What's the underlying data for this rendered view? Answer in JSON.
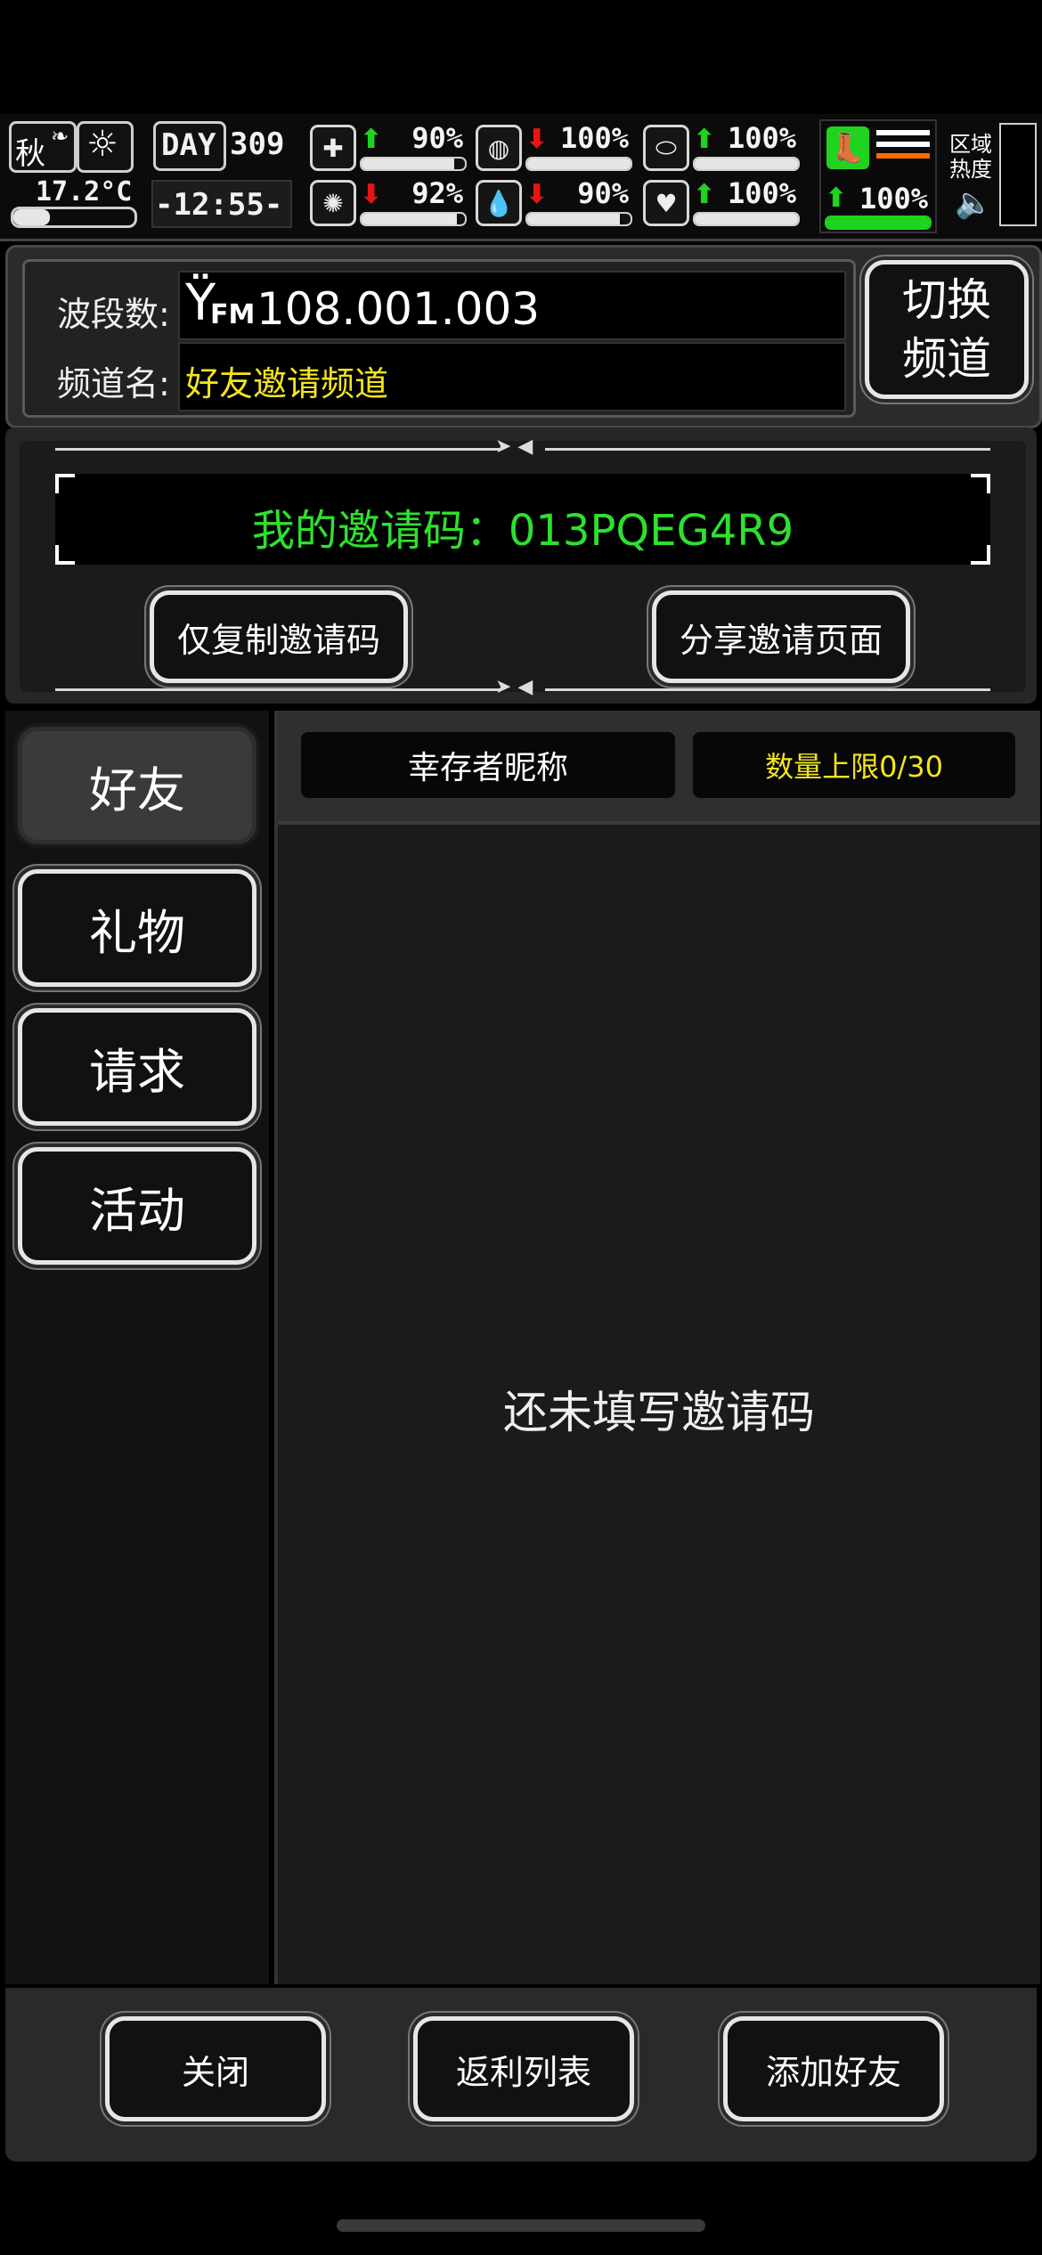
{
  "hud": {
    "season": "秋",
    "temperature": "17.2°C",
    "day_label": "DAY",
    "day_number": "309",
    "clock": "-12:55-",
    "stats": [
      {
        "name": "health",
        "icon": "medkit-icon",
        "trend": "up",
        "value": "90%",
        "level": 0.9
      },
      {
        "name": "hunger",
        "icon": "stomach-icon",
        "trend": "down",
        "value": "100%",
        "level": 1.0
      },
      {
        "name": "medicine",
        "icon": "pill-icon",
        "trend": "up",
        "value": "100%",
        "level": 1.0
      },
      {
        "name": "mood",
        "icon": "brain-icon",
        "trend": "down",
        "value": "92%",
        "level": 0.92
      },
      {
        "name": "thirst",
        "icon": "water-drop-icon",
        "trend": "down",
        "value": "90%",
        "level": 0.9
      },
      {
        "name": "heart",
        "icon": "heart-icon",
        "trend": "up",
        "value": "100%",
        "level": 1.0
      }
    ],
    "stamina": {
      "trend": "up",
      "value": "100%",
      "level": 1.0
    },
    "region_heat_label": "区域\n热度"
  },
  "channel": {
    "band_label": "波段数:",
    "band_prefix": "FM",
    "band_value": "108.001.003",
    "name_label": "频道名:",
    "name_value": "好友邀请频道",
    "switch_button": "切换\n频道"
  },
  "invite": {
    "code_text": "我的邀请码：013PQEG4R9",
    "copy_button": "仅复制邀请码",
    "share_button": "分享邀请页面"
  },
  "tabs": [
    {
      "id": "friends",
      "label": "好友",
      "active": true
    },
    {
      "id": "gifts",
      "label": "礼物",
      "active": false
    },
    {
      "id": "requests",
      "label": "请求",
      "active": false
    },
    {
      "id": "events",
      "label": "活动",
      "active": false
    }
  ],
  "list": {
    "col_nickname": "幸存者昵称",
    "col_limit": "数量上限0/30",
    "empty_message": "还未填写邀请码"
  },
  "footer": {
    "close": "关闭",
    "rebate_list": "返利列表",
    "add_friend": "添加好友"
  },
  "colors": {
    "accent_green": "#1fd31f",
    "warn_red": "#e81414",
    "yellow_text": "#f4e51c",
    "invite_green": "#2fe02f"
  }
}
